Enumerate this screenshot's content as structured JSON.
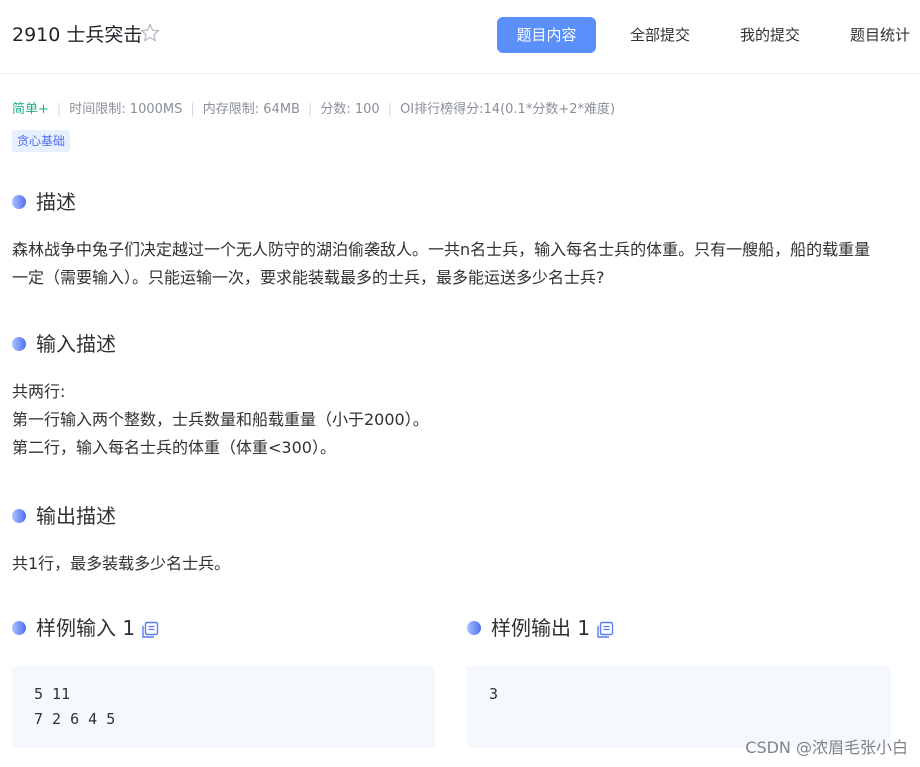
{
  "problem": {
    "title": "2910 士兵突击"
  },
  "tabs": [
    {
      "label": "题目内容",
      "active": true
    },
    {
      "label": "全部提交",
      "active": false
    },
    {
      "label": "我的提交",
      "active": false
    },
    {
      "label": "题目统计",
      "active": false
    }
  ],
  "meta": {
    "difficulty": "简单+",
    "time_limit": "时间限制: 1000MS",
    "memory_limit": "内存限制: 64MB",
    "score": "分数: 100",
    "oi_score": "OI排行榜得分:14(0.1*分数+2*难度)"
  },
  "tag": "贪心基础",
  "sections": {
    "description": {
      "title": "描述",
      "lines": [
        "森林战争中兔子们决定越过一个无人防守的湖泊偷袭敌人。一共n名士兵，输入每名士兵的体重。只有一艘船，船的载重量",
        "一定（需要输入）。只能运输一次，要求能装载最多的士兵，最多能运送多少名士兵?"
      ]
    },
    "input": {
      "title": "输入描述",
      "lines": [
        "共两行:",
        "第一行输入两个整数，士兵数量和船载重量（小于2000）。",
        "第二行，输入每名士兵的体重（体重<300）。"
      ]
    },
    "output": {
      "title": "输出描述",
      "lines": [
        "共1行，最多装载多少名士兵。"
      ]
    },
    "sample_input": {
      "title": "样例输入 1",
      "code": "5 11\n7 2 6 4 5"
    },
    "sample_output": {
      "title": "样例输出 1",
      "code": "3"
    }
  },
  "watermark": "CSDN @浓眉毛张小白",
  "colors": {
    "accent": "#5b8ff9",
    "difficulty": "#1cb38c",
    "tag_bg": "#e8effd",
    "code_bg": "#f5f8fc"
  }
}
